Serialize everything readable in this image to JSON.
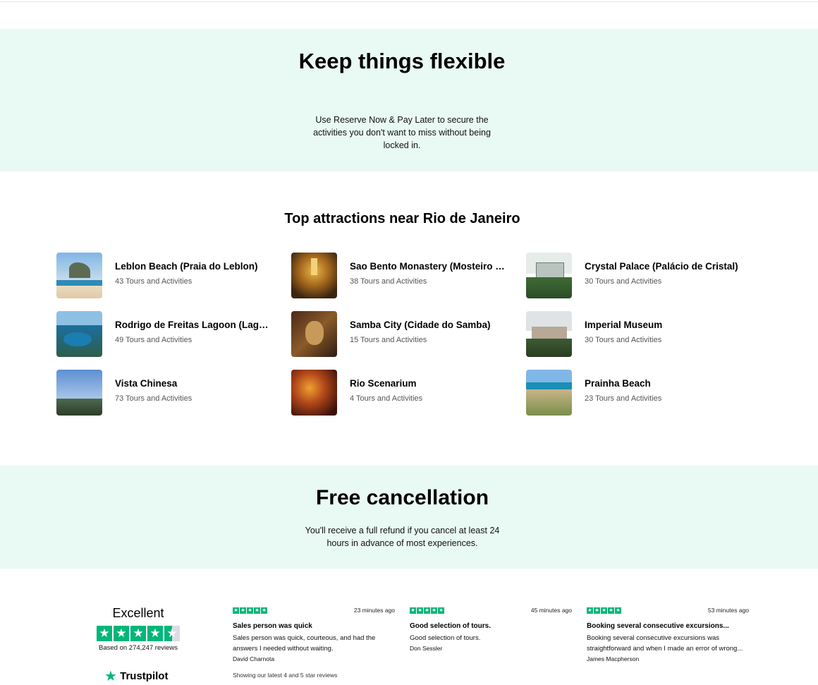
{
  "flexible": {
    "title": "Keep things flexible",
    "description": "Use Reserve Now & Pay Later to secure the activities you don't want to miss without being locked in."
  },
  "attractions": {
    "heading": "Top attractions near Rio de Janeiro",
    "items": [
      {
        "name": "Leblon Beach (Praia do Leblon)",
        "count": "43 Tours and Activities"
      },
      {
        "name": "Sao Bento Monastery (Mosteiro de São Bento)",
        "count": "38 Tours and Activities"
      },
      {
        "name": "Crystal Palace (Palácio de Cristal)",
        "count": "30 Tours and Activities"
      },
      {
        "name": "Rodrigo de Freitas Lagoon (Lagoa Rodrigo de Freitas)",
        "count": "49 Tours and Activities"
      },
      {
        "name": "Samba City (Cidade do Samba)",
        "count": "15 Tours and Activities"
      },
      {
        "name": "Imperial Museum",
        "count": "30 Tours and Activities"
      },
      {
        "name": "Vista Chinesa",
        "count": "73 Tours and Activities"
      },
      {
        "name": "Rio Scenarium",
        "count": "4 Tours and Activities"
      },
      {
        "name": "Prainha Beach",
        "count": "23 Tours and Activities"
      }
    ]
  },
  "free_cancellation": {
    "title": "Free cancellation",
    "description": "You'll receive a full refund if you cancel at least 24 hours in advance of most experiences."
  },
  "trustpilot": {
    "rating_word": "Excellent",
    "based_on": "Based on 274,247 reviews",
    "logo_text": "Trustpilot",
    "reviews": [
      {
        "time": "23 minutes ago",
        "title": "Sales person was quick",
        "body": "Sales person was quick, courteous, and had the answers I needed without waiting.",
        "author": "David Charnota"
      },
      {
        "time": "45 minutes ago",
        "title": "Good selection of tours.",
        "body": "Good selection of tours.",
        "author": "Don Sessler"
      },
      {
        "time": "53 minutes ago",
        "title": "Booking several consecutive excursions...",
        "body": "Booking several consecutive excursions was straightforward and when I made an error of wrong...",
        "author": "James Macpherson"
      }
    ],
    "more_text": "Showing our latest 4 and 5 star reviews"
  },
  "colors": {
    "band": "#e9f9f4",
    "trustpilot_green": "#00b67a"
  }
}
